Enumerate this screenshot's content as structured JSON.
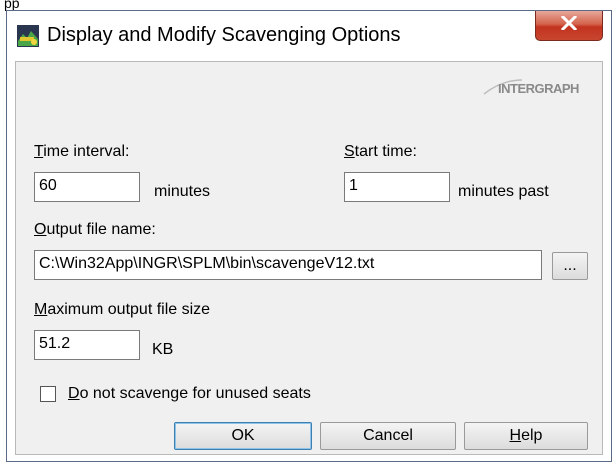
{
  "window": {
    "title": "Display and Modify Scavenging Options",
    "brand_logo": "INTERGRAPH",
    "close_symbol": "X"
  },
  "form": {
    "time_interval": {
      "label_mnemonic": "T",
      "label_rest": "ime interval:",
      "value": "60",
      "unit": "minutes"
    },
    "start_time": {
      "label_mnemonic": "S",
      "label_rest": "tart time:",
      "value": "1",
      "unit": "minutes past"
    },
    "output_file": {
      "label_mnemonic": "O",
      "label_rest": "utput file name:",
      "value": "C:\\Win32App\\INGR\\SPLM\\bin\\scavengeV12.txt",
      "browse_label": "..."
    },
    "max_size": {
      "label_mnemonic": "M",
      "label_rest": "aximum output file size",
      "value": "51.2",
      "unit": "KB"
    },
    "no_scavenge": {
      "label_mnemonic": "D",
      "label_rest": "o not scavenge for unused seats",
      "checked": false
    }
  },
  "buttons": {
    "ok": "OK",
    "cancel": "Cancel",
    "help_mnemonic": "H",
    "help_rest": "elp"
  },
  "colors": {
    "close_red": "#c8462f",
    "dialog_bg": "#f0f0f0"
  }
}
